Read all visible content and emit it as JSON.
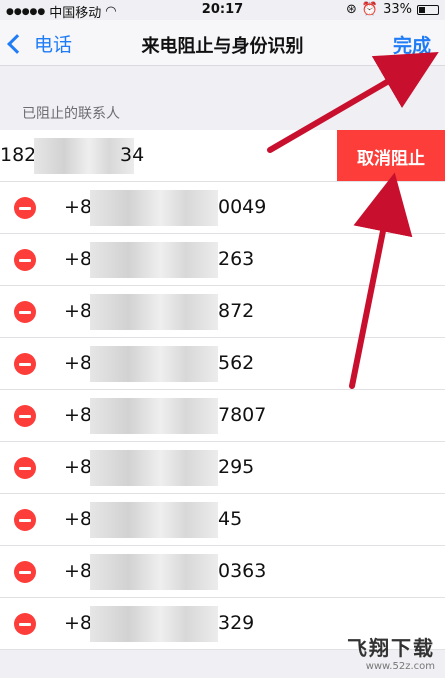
{
  "status_bar": {
    "carrier": "中国移动",
    "time": "20:17",
    "battery_text": "33%",
    "battery_level": 0.33
  },
  "nav": {
    "back_label": "电话",
    "title": "来电阻止与身份识别",
    "done_label": "完成"
  },
  "section": {
    "header": "已阻止的联系人"
  },
  "contacts": [
    {
      "prefix": "182-",
      "suffix": "34",
      "swiped": true
    },
    {
      "prefix": "+8",
      "suffix": "0049"
    },
    {
      "prefix": "+8",
      "suffix": "263"
    },
    {
      "prefix": "+8",
      "suffix": "872"
    },
    {
      "prefix": "+8",
      "suffix": "562"
    },
    {
      "prefix": "+8",
      "suffix": "7807"
    },
    {
      "prefix": "+8",
      "suffix": "295"
    },
    {
      "prefix": "+8",
      "suffix": "45"
    },
    {
      "prefix": "+8",
      "suffix": "0363"
    },
    {
      "prefix": "+8",
      "suffix": "329"
    }
  ],
  "unblock_label": "取消阻止",
  "watermark": {
    "logo": "飞翔下载",
    "url": "www.52z.com"
  },
  "colors": {
    "accent": "#1f7cf6",
    "delete": "#fc3d39",
    "annotation_arrow": "#c8102e"
  }
}
